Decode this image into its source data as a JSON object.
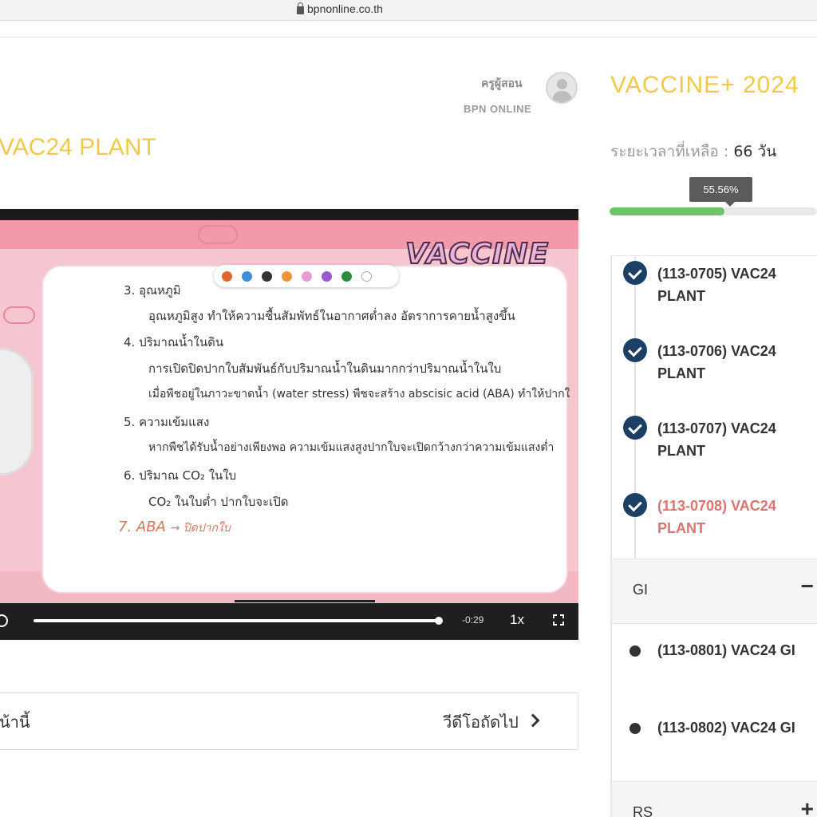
{
  "browser": {
    "url": "bpnonline.co.th"
  },
  "teacher": {
    "label": "ครูผู้สอน",
    "org": "BPN ONLINE"
  },
  "lesson": {
    "title": "VAC24 PLANT"
  },
  "course": {
    "title": "VACCINE+ 2024",
    "remaining_label": "ระยะเวลาที่เหลือ :",
    "remaining_value": "66 วัน",
    "progress_text": "55.56%",
    "progress_fraction": 0.5556,
    "progress_color": "#6bc36b"
  },
  "playlist": {
    "items": [
      {
        "label": "(113-0705) VAC24 PLANT",
        "done": true
      },
      {
        "label": "(113-0706) VAC24 PLANT",
        "done": true
      },
      {
        "label": "(113-0707) VAC24 PLANT",
        "done": true
      },
      {
        "label": "(113-0708) VAC24 PLANT",
        "done": true,
        "active": true
      }
    ],
    "sections": [
      {
        "label": "GI",
        "toggle": "−"
      },
      {
        "label": "RS",
        "toggle": "+"
      }
    ],
    "gi_items": [
      {
        "label": "(113-0801) VAC24 GI"
      },
      {
        "label": "(113-0802) VAC24 GI"
      }
    ]
  },
  "video": {
    "logo": "VACCINE",
    "time": "-0:29",
    "speed": "1x",
    "palette_colors": [
      "#e0662f",
      "#3b8fd9",
      "#333333",
      "#f0943c",
      "#e79bd6",
      "#9b57d3",
      "#2e8c3f",
      "#ffffff"
    ],
    "slide_lines": [
      "3.   อุณหภูมิ",
      "อุณหภูมิสูง ทำให้ความชื้นสัมพัทธ์ในอากาศต่ำลง อัตราการคายน้ำสูงขึ้น",
      "4.   ปริมาณน้ำในดิน",
      "การเปิดปิดปากใบสัมพันธ์กับปริมาณน้ำในดินมากกว่าปริมาณน้ำในใบ",
      "เมื่อพืชอยู่ในภาวะขาดน้ำ (water stress) พืชจะสร้าง abscisic acid (ABA) ทำให้ปากใ",
      "5.   ความเข้มแสง",
      "หากพืชได้รับน้ำอย่างเพียงพอ ความเข้มแสงสูงปากใบจะเปิดกว้างกว่าความเข้มแสงต่ำ",
      "6.   ปริมาณ CO₂ ในใบ",
      "CO₂ ในใบต่ำ ปากใบจะเปิด"
    ],
    "handwriting": "7. ABA",
    "handwriting_note": "→ ปิดปากใบ"
  },
  "nav": {
    "prev_label": "น้านี้",
    "next_label": "วีดีโอถัดไป"
  }
}
